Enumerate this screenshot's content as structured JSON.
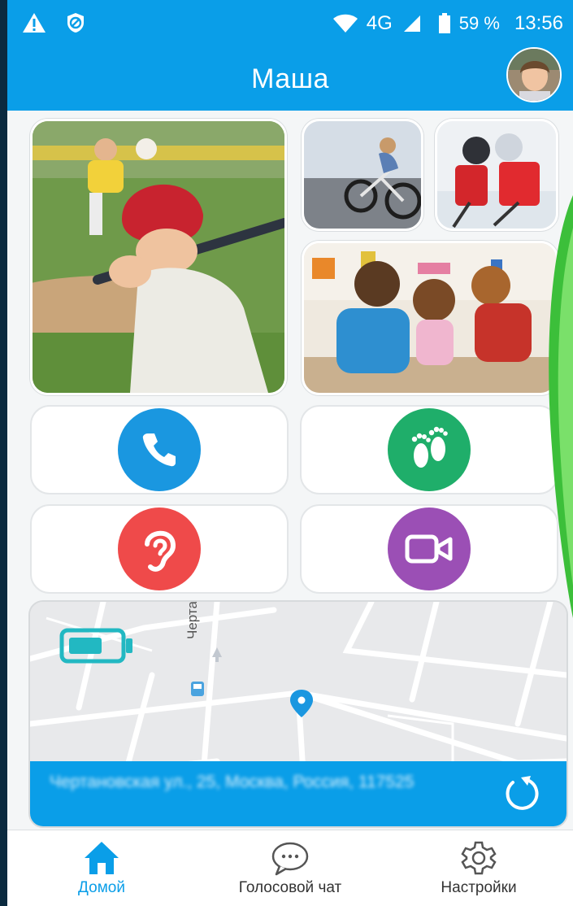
{
  "status_bar": {
    "left_icons": [
      "warning-icon",
      "blocked-icon"
    ],
    "network": "4G",
    "battery_percent": "59 %",
    "time": "13:56"
  },
  "app_bar": {
    "title": "Маша",
    "avatar": "child-avatar"
  },
  "photos": [
    {
      "name": "photo-baseball-boy"
    },
    {
      "name": "photo-girl-bicycle"
    },
    {
      "name": "photo-kids-hockey"
    },
    {
      "name": "photo-kids-playing"
    }
  ],
  "actions": [
    {
      "name": "call",
      "icon": "phone-icon",
      "color": "#1a97e0"
    },
    {
      "name": "steps",
      "icon": "footprints-icon",
      "color": "#1fae6a"
    },
    {
      "name": "listen",
      "icon": "ear-icon",
      "color": "#ef4a4a"
    },
    {
      "name": "video",
      "icon": "video-camera-icon",
      "color": "#9b4fb5"
    }
  ],
  "map": {
    "street_label": "Чертанов",
    "device_battery_icon": "battery-icon",
    "address": "Чертановская ул., 25, Москва, Россия, 117525",
    "refresh_icon": "refresh-icon"
  },
  "bottom_nav": {
    "items": [
      {
        "label": "Домой",
        "icon": "home-icon",
        "active": true
      },
      {
        "label": "Голосовой чат",
        "icon": "chat-bubble-icon",
        "active": false
      },
      {
        "label": "Настройки",
        "icon": "gear-icon",
        "active": false
      }
    ]
  },
  "colors": {
    "accent": "#0a9ee8",
    "background": "#f4f6f7"
  }
}
